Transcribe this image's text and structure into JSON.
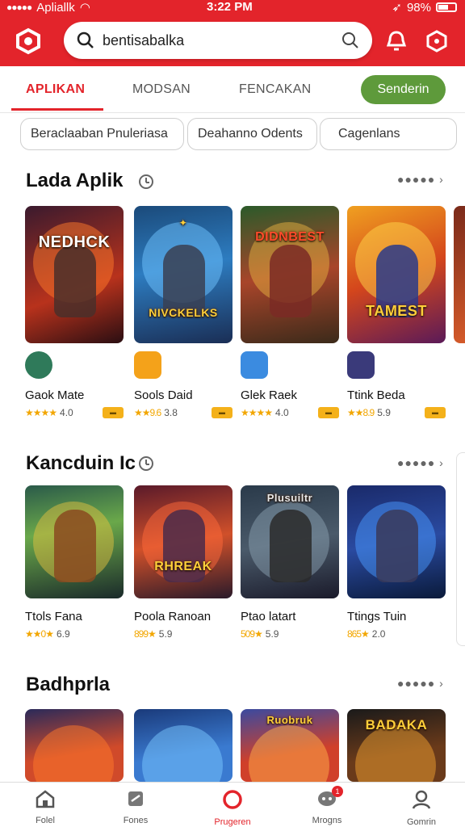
{
  "status": {
    "carrier": "Apliallk",
    "time": "3:22 PM",
    "battery": "98%"
  },
  "header": {
    "search_value": "bentisabalka"
  },
  "tabs": [
    {
      "label": "APLIKAN",
      "active": true
    },
    {
      "label": "MODSAN",
      "active": false
    },
    {
      "label": "FENCAKAN",
      "active": false
    }
  ],
  "tab_button": "Senderin",
  "chips": [
    "Beraclaaban Pnuleriasa",
    "Deahanno Odents",
    "Cagenlans"
  ],
  "sections": [
    {
      "title": "Lada Aplik",
      "items": [
        {
          "art_title": "NEDHCK",
          "name": "Gaok Mate",
          "stars": "★★★★",
          "score": "4.0"
        },
        {
          "art_title": "NIVCKELKS",
          "name": "Sools Daid",
          "stars": "★★9.6",
          "score": "3.8"
        },
        {
          "art_title": "DIDNBEST",
          "name": "Glek Raek",
          "stars": "★★★★",
          "score": "4.0"
        },
        {
          "art_title": "TAMEST",
          "name": "Ttink Beda",
          "stars": "★★8.9",
          "score": "5.9"
        }
      ]
    },
    {
      "title": "Kancduin Ic",
      "items": [
        {
          "art_title": "",
          "name": "Ttols Fana",
          "stars": "★★0★",
          "score": "6.9"
        },
        {
          "art_title": "RHREAK",
          "name": "Poola Ranoan",
          "stars": "899★",
          "score": "5.9"
        },
        {
          "art_title": "Plusuiltr",
          "name": "Ptao latart",
          "stars": "509★",
          "score": "5.9"
        },
        {
          "art_title": "",
          "name": "Ttings Tuin",
          "stars": "865★",
          "score": "2.0"
        }
      ]
    },
    {
      "title": "Badhprla",
      "items": [
        {
          "art_title": ""
        },
        {
          "art_title": ""
        },
        {
          "art_title": "Ruobruk"
        },
        {
          "art_title": "BADAKA"
        }
      ]
    }
  ],
  "bottom_nav": [
    {
      "label": "Folel",
      "icon": "home-icon"
    },
    {
      "label": "Fones",
      "icon": "games-icon"
    },
    {
      "label": "Prugeren",
      "icon": "ring-icon",
      "active": true
    },
    {
      "label": "Mrogns",
      "icon": "chat-icon",
      "badge": "1"
    },
    {
      "label": "Gomrin",
      "icon": "profile-icon"
    }
  ],
  "colors": {
    "brand_red": "#e3242b",
    "accent_green": "#5e9a3b",
    "star_gold": "#f2a600"
  }
}
